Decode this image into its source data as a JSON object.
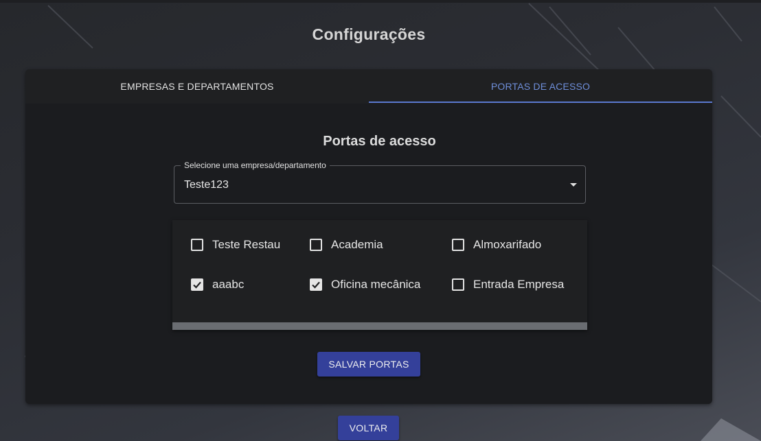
{
  "page": {
    "title": "Configurações"
  },
  "tabs": [
    {
      "label": "EMPRESAS E DEPARTAMENTOS",
      "active": false
    },
    {
      "label": "PORTAS DE ACESSO",
      "active": true
    }
  ],
  "section": {
    "title": "Portas de acesso"
  },
  "select": {
    "label": "Selecione uma empresa/departamento",
    "value": "Teste123"
  },
  "doors": [
    {
      "label": "Teste Restau",
      "checked": false
    },
    {
      "label": "Academia",
      "checked": false
    },
    {
      "label": "Almoxarifado",
      "checked": false
    },
    {
      "label": "aaabc",
      "checked": true
    },
    {
      "label": "Oficina mecânica",
      "checked": true
    },
    {
      "label": "Entrada Empresa",
      "checked": false
    }
  ],
  "buttons": {
    "save_label": "SALVAR PORTAS",
    "back_label": "VOLTAR"
  },
  "colors": {
    "accent": "#5a78d0",
    "button": "#34409a",
    "card": "#1b1c1f"
  }
}
